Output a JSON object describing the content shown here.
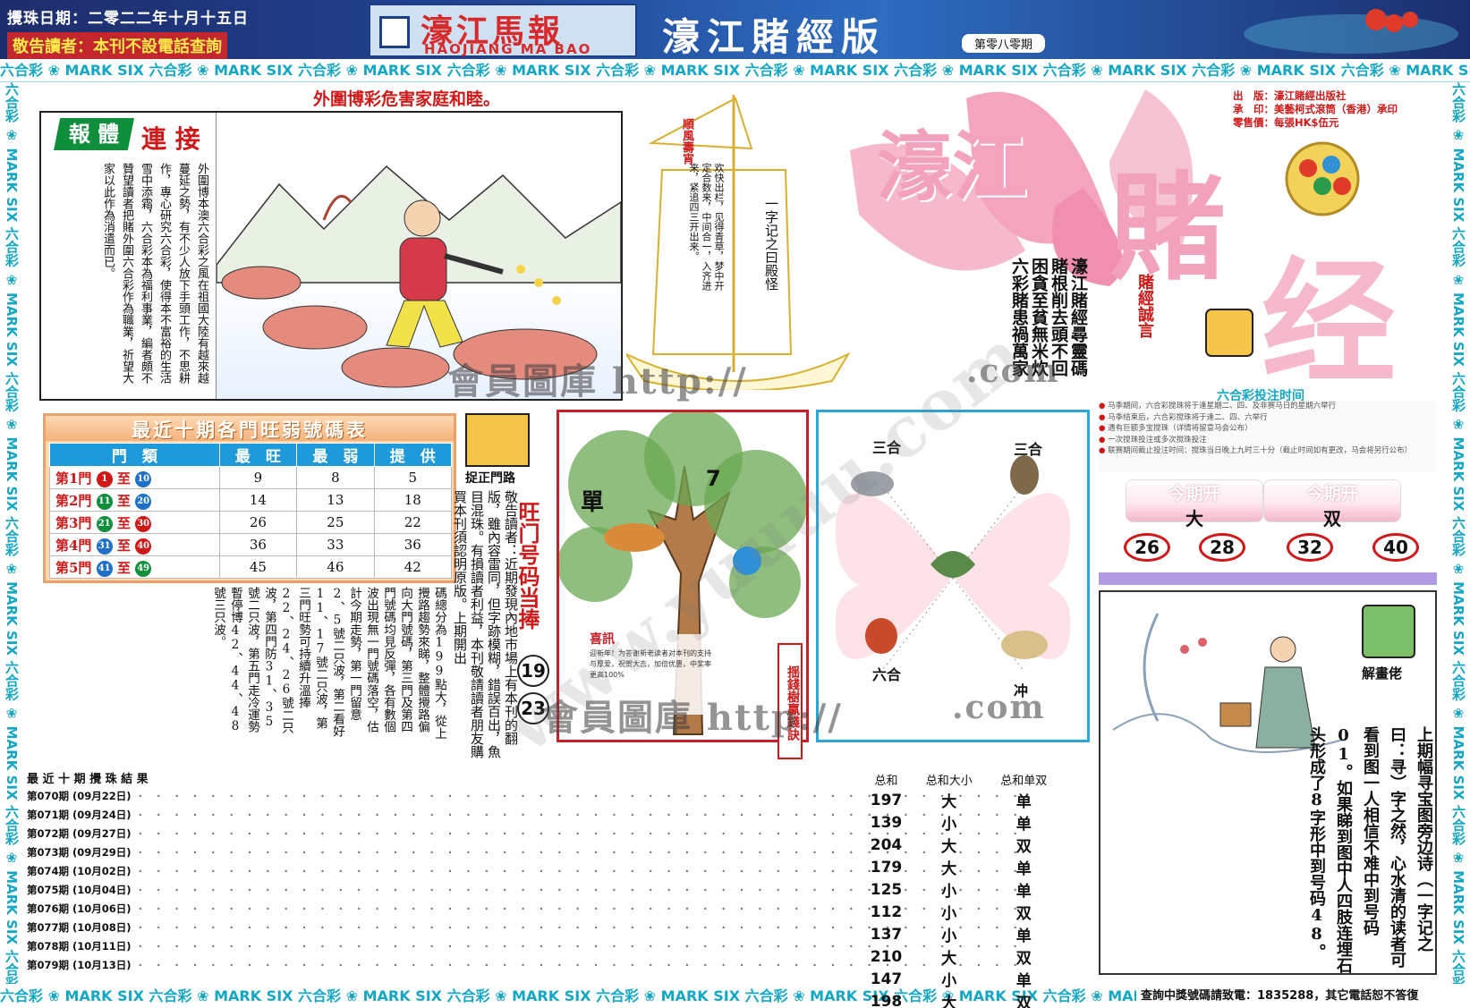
{
  "header": {
    "date": "攪珠日期：二零二二年十月十五日",
    "notice": "敬告讀者：本刊不設電話查詢",
    "masthead_cn": "濠江馬報",
    "masthead_en": "HAOJIANG MA BAO",
    "edition": "濠江賭經版",
    "issue": "第零八零期"
  },
  "border": {
    "segment": "六合彩 ❀ MARK SIX ",
    "hotline": "查詢中獎號碼請致電：1835288，其它電話恕不答復"
  },
  "warning": "外圍博彩危害家庭和睦。",
  "ad": {
    "tag_a": "報 體",
    "tag_b": "連 接",
    "text": "外圍博本澳六合彩之風在祖國大陸有越來越蔓延之勢，有不少人放下手頭工作，不思耕作，專心研究六合彩，使得本不富裕的生活雪中添霜，六合彩本為福利事業，編者頗不贊望讀者把賭外圍六合彩作為職業，祈望大家以此作為消遣而已。"
  },
  "boat": {
    "flag": "順風壽宵",
    "poem": "一字记之曰殿怪",
    "poem_small": "欢快出栏，见得青草，梦中开定合数来，中间合一，入齐进来，紧追四三开出来。"
  },
  "title_art": {
    "big_1": "濠江",
    "big_2": "賭",
    "big_3": "经",
    "cols": [
      "六彩賭患禍萬家",
      "困貪至貧無米炊",
      "賭根削去頭不回",
      "濠江賭經尋靈碼"
    ],
    "motto": "賭經誠言",
    "pub": [
      "出　版：濠江賭經出版社",
      "承　印：美藝柯式滾筒（香港）承印",
      "零售價：每張HK$伍元"
    ]
  },
  "bet": {
    "title": "六合彩投注时间",
    "items": [
      "马季期间，六合彩搅珠将于逢星期二、四、及非赛马日的星期六举行",
      "马季结束后，六合彩搅珠将于逢二、四、六举行",
      "遇有巨额多宝搅珠（详情将留意马会公布）",
      "一次搅珠投注或多次搅珠投注",
      "联赛期间截止投注时间：搅珠当日晚上九时三十分（截止时间如有更改，马会将另行公布）"
    ]
  },
  "ws_table": {
    "title": "最近十期各門旺弱號碼表",
    "headers": [
      "門　類",
      "最　旺",
      "最　弱",
      "提　供"
    ],
    "rows": [
      {
        "gate": "第1門",
        "from": "1",
        "to": "10",
        "hot": "9",
        "cold": "8",
        "tip": "5",
        "c1": "#d01818",
        "c2": "#1e70c8"
      },
      {
        "gate": "第2門",
        "from": "11",
        "to": "20",
        "hot": "14",
        "cold": "13",
        "tip": "18",
        "c1": "#0f8e3c",
        "c2": "#1e70c8"
      },
      {
        "gate": "第3門",
        "from": "21",
        "to": "30",
        "hot": "26",
        "cold": "25",
        "tip": "22",
        "c1": "#0f8e3c",
        "c2": "#d01818"
      },
      {
        "gate": "第4門",
        "from": "31",
        "to": "40",
        "hot": "36",
        "cold": "33",
        "tip": "36",
        "c1": "#1e70c8",
        "c2": "#d01818"
      },
      {
        "gate": "第5門",
        "from": "41",
        "to": "49",
        "hot": "45",
        "cold": "46",
        "tip": "42",
        "c1": "#1e70c8",
        "c2": "#0f8e3c"
      }
    ],
    "to_word": "至"
  },
  "gate": {
    "label": "捉正門路",
    "title": "旺门号码当捧",
    "n1": "19",
    "n2": "23",
    "text": "敬告讀者：近期發現內地市場上有本刊的翻版，雖內容雷同，但字跡模糊，錯誤百出，魚目混珠。有損讀者利益，本刊敬請讀者朋友購買本刊須認明原版。上期開出"
  },
  "narr": "碼總分為199點大，從上攪路趨勢來睇，整體攪路偏向大門號碼，第三門及第四門號碼均見反彈，各有數個波出現無一門號碼落空，估計今期走勢，第一門留意2、5號二只波，第二看好11、17號二只波，第三門旺勢可持續升溫捧22、24、26號二只波，第四門防31、35號二只波，第五門走冷運勢暫停博42、44、48號三只波。",
  "tree": {
    "dan": "單",
    "seven": "7",
    "vtag": "揺錢樹贏錢訣",
    "xi_title": "喜訊",
    "xi_text": "迎新年！为答谢新老读者对本刊的支持与厚爱，祝贺大吉，加倍优惠，中奖率更高100%"
  },
  "zodiac": {
    "tl": "三合",
    "tr": "三合",
    "bl": "六合",
    "br": "冲"
  },
  "draw": {
    "label": "今期开",
    "v1": "大",
    "v2": "双",
    "nums": [
      "26",
      "28",
      "32",
      "40"
    ]
  },
  "riddle": {
    "label": "解畫佬",
    "text": "上期幅寻宝图旁边诗（一字记之曰：寻）字之然，心水清的读者可看到图一人相信不难中到号码01。如果睇到图中人四肢连埋石头形成了8字形中到号码48。"
  },
  "results": {
    "title": "最 近 十 期 攪 珠 結 果",
    "sum_headers": [
      "总和",
      "总和大小",
      "总和单双"
    ],
    "rows": [
      {
        "issue": "第070期",
        "date": "(09月22日)",
        "sum": "197",
        "size": "大",
        "parity": "单"
      },
      {
        "issue": "第071期",
        "date": "(09月24日)",
        "sum": "139",
        "size": "小",
        "parity": "单"
      },
      {
        "issue": "第072期",
        "date": "(09月27日)",
        "sum": "204",
        "size": "大",
        "parity": "双"
      },
      {
        "issue": "第073期",
        "date": "(09月29日)",
        "sum": "179",
        "size": "大",
        "parity": "单"
      },
      {
        "issue": "第074期",
        "date": "(10月02日)",
        "sum": "125",
        "size": "小",
        "parity": "单"
      },
      {
        "issue": "第075期",
        "date": "(10月04日)",
        "sum": "112",
        "size": "小",
        "parity": "双"
      },
      {
        "issue": "第076期",
        "date": "(10月06日)",
        "sum": "137",
        "size": "小",
        "parity": "单"
      },
      {
        "issue": "第077期",
        "date": "(10月08日)",
        "sum": "210",
        "size": "大",
        "parity": "双"
      },
      {
        "issue": "第078期",
        "date": "(10月11日)",
        "sum": "147",
        "size": "小",
        "parity": "单"
      },
      {
        "issue": "第079期",
        "date": "(10月13日)",
        "sum": "198",
        "size": "大",
        "parity": "双"
      }
    ]
  },
  "watermarks": {
    "w1": "會員圖庫 http://",
    "w2": ".com",
    "w3": "會員圖庫 http://",
    "w4": ".com",
    "diag": "www.yuuuu.com"
  },
  "colors": {
    "red": "#d01818",
    "blue": "#1e70c8",
    "green": "#0f8e3c",
    "cyan": "#14a7c4",
    "pink": "#f6b9cb"
  }
}
